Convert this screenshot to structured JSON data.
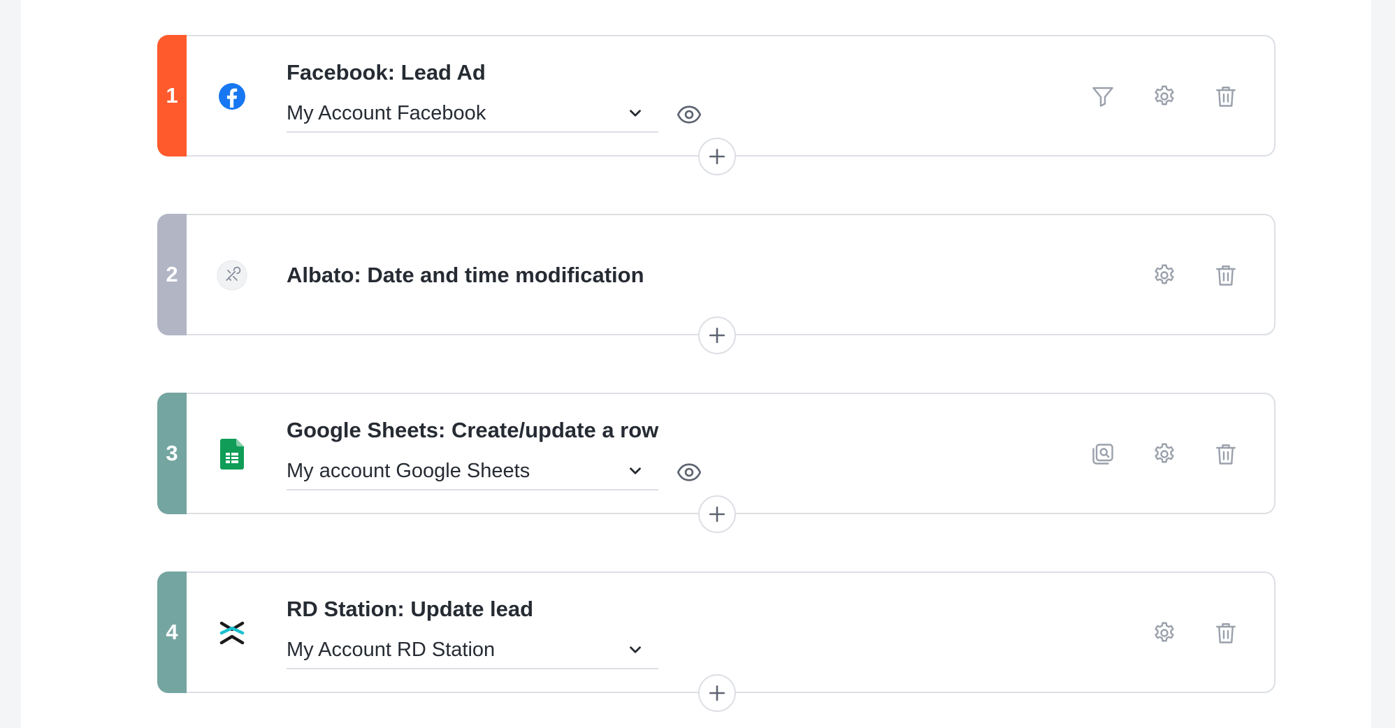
{
  "steps": [
    {
      "number": "1",
      "color": "#ff5a2c",
      "icon": "facebook-icon",
      "title": "Facebook: Lead Ad",
      "account": "My Account Facebook",
      "actions": [
        "filter-icon",
        "gear-icon",
        "trash-icon"
      ]
    },
    {
      "number": "2",
      "color": "#b2b5c4",
      "icon": "tools-icon",
      "title": "Albato: Date and time modification",
      "actions": [
        "gear-icon",
        "trash-icon"
      ]
    },
    {
      "number": "3",
      "color": "#75a5a0",
      "icon": "google-sheets-icon",
      "title": "Google Sheets: Create/update a row",
      "account": "My account Google Sheets",
      "actions": [
        "search-record-icon",
        "gear-icon",
        "trash-icon"
      ]
    },
    {
      "number": "4",
      "color": "#75a5a0",
      "icon": "rd-station-icon",
      "title": "RD Station: Update lead",
      "account": "My Account RD Station",
      "actions": [
        "gear-icon",
        "trash-icon"
      ]
    }
  ]
}
